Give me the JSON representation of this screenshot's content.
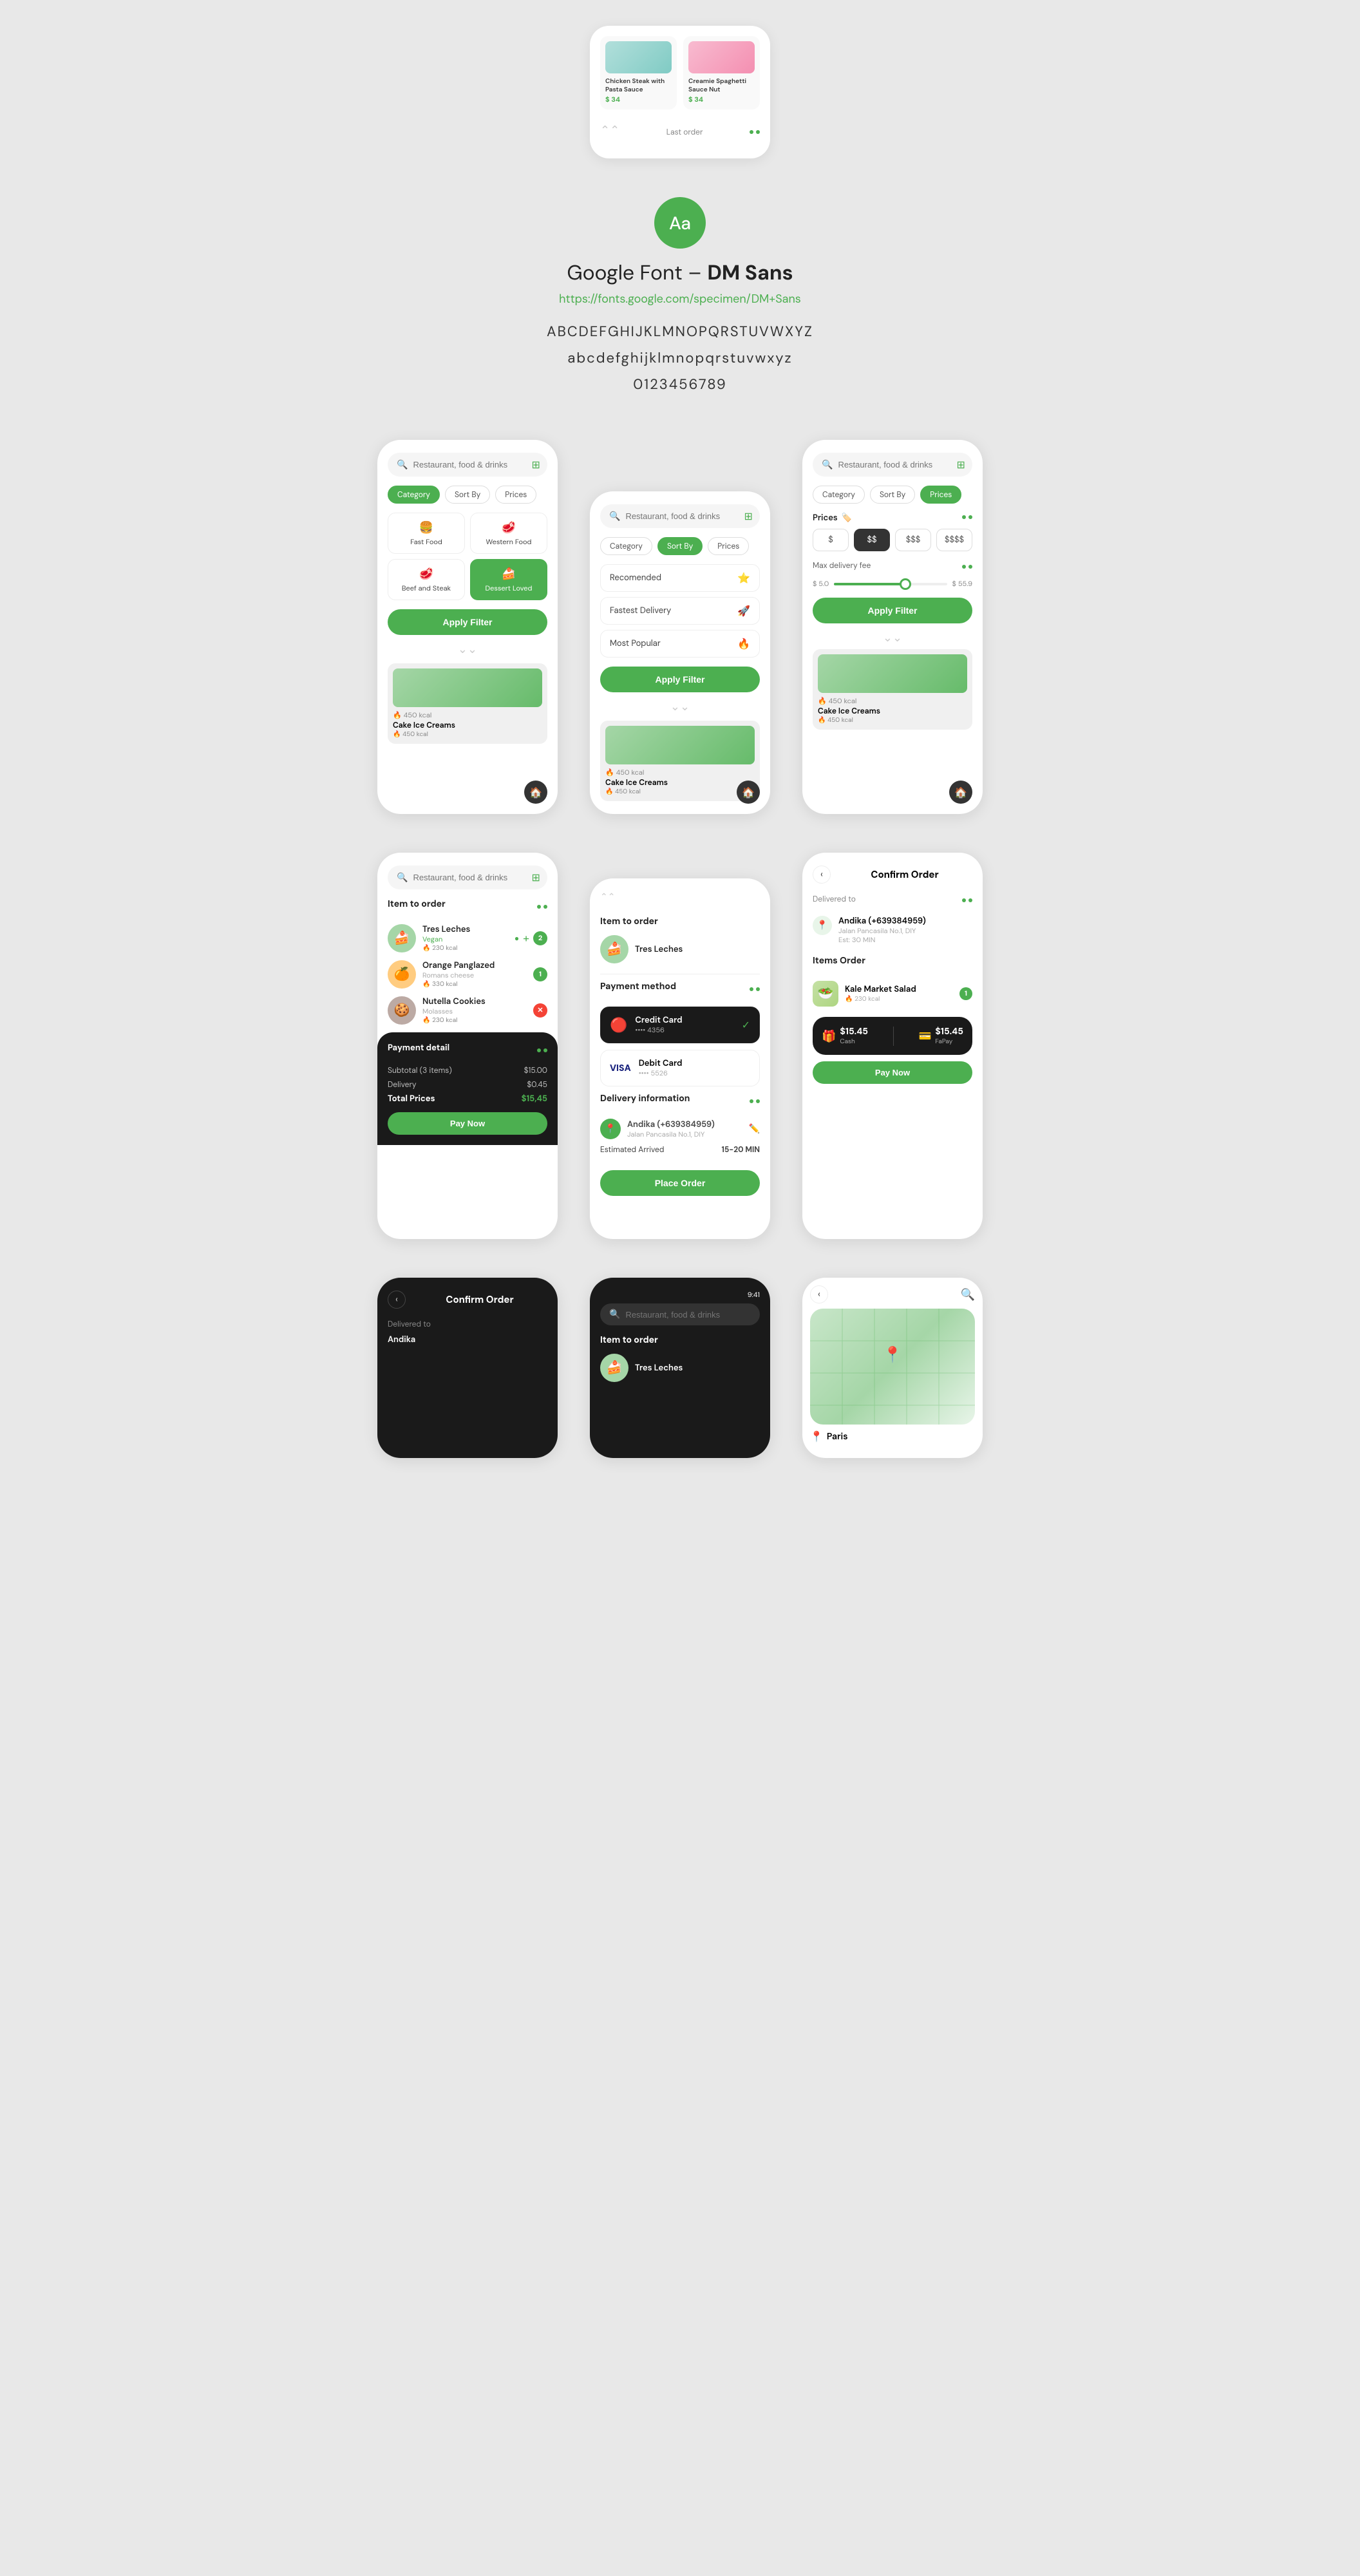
{
  "top": {
    "partial_phone": {
      "food_cards": [
        {
          "name": "Chicken Steak with Pasta Sauce",
          "price": "$ 34"
        },
        {
          "name": "Creamie Spaghetti Sauce Nut",
          "price": "$ 34"
        }
      ],
      "last_order_label": "Last order"
    }
  },
  "font_section": {
    "circle_label": "Aa",
    "title_normal": "Google Font –",
    "title_bold": "DM Sans",
    "link": "https://fonts.google.com/specimen/DM+Sans",
    "uppercase": "ABCDEFGHIJKLMNOPQRSTUVWXYZ",
    "lowercase": "abcdefghijklmnopqrstuvwxyz",
    "numbers": "0123456789"
  },
  "phones_row1": {
    "phone1": {
      "search_placeholder": "Restaurant, food & drinks",
      "pills": [
        "Category",
        "Sort By",
        "Prices"
      ],
      "active_pill": "Category",
      "categories": [
        {
          "icon": "🍔",
          "label": "Fast Food",
          "active": false
        },
        {
          "icon": "🥩",
          "label": "Western Food",
          "active": false
        },
        {
          "icon": "🥩",
          "label": "Beef and Steak",
          "active": false
        },
        {
          "icon": "🍰",
          "label": "Dessert Loved",
          "active": true
        }
      ],
      "apply_btn": "Apply Filter"
    },
    "phone2": {
      "search_placeholder": "Restaurant, food & drinks",
      "pills": [
        "Category",
        "Sort By",
        "Prices"
      ],
      "active_pill": "Sort By",
      "sort_options": [
        {
          "label": "Recomended",
          "icon": "⭐"
        },
        {
          "label": "Fastest Delivery",
          "icon": "🚀"
        },
        {
          "label": "Most Popular",
          "icon": "🔥"
        }
      ],
      "apply_btn": "Apply Filter"
    },
    "phone3": {
      "search_placeholder": "Restaurant, food & drinks",
      "pills": [
        "Category",
        "Sort By",
        "Prices"
      ],
      "active_pill": "Prices",
      "prices_label": "Prices",
      "price_options": [
        "$",
        "$$",
        "$$$",
        "$$$$"
      ],
      "active_price": "$$",
      "delivery_label": "Max delivery fee",
      "slider_min": "$ 5.0",
      "slider_max": "$ 55.9",
      "apply_btn": "Apply Filter"
    }
  },
  "phones_row2": {
    "phone1": {
      "search_placeholder": "Restaurant, food & drinks",
      "section_title": "Item to order",
      "items": [
        {
          "name": "Tres Leches",
          "sub": "Vegan",
          "cal": "230 kcal",
          "qty": 2,
          "badge_color": "green"
        },
        {
          "name": "Orange Panglazed",
          "sub": "Romans cheese",
          "cal": "330 kcal",
          "qty": 1,
          "badge_color": "green"
        },
        {
          "name": "Nutella Cookies",
          "sub": "Molasses",
          "cal": "230 kcal",
          "qty": null,
          "badge_color": "red"
        }
      ],
      "payment_detail": {
        "title": "Payment detail",
        "subtotal_label": "Subtotal (3 items)",
        "subtotal_val": "$15.00",
        "delivery_label": "Delivery",
        "delivery_val": "$0.45",
        "total_label": "Total Prices",
        "total_val": "$15,45",
        "pay_btn": "Pay Now"
      }
    },
    "phone2": {
      "section_title": "Item to order",
      "item_name": "Tres Leches",
      "payment_method_title": "Payment method",
      "payment_methods": [
        {
          "name": "Credit Card",
          "num": "•••• 4356",
          "icon": "💳",
          "active": true
        },
        {
          "name": "Debit Card",
          "num": "•••• 5526",
          "icon": "💳",
          "active": false
        }
      ],
      "delivery_info_title": "Delivery information",
      "delivery_name": "Andika (+639384959)",
      "delivery_addr": "Jalan Pancasila No.1, DIY",
      "eta_label": "Estimated Arrived",
      "eta_val": "15-20 MIN",
      "place_order_btn": "Place Order"
    },
    "phone3": {
      "confirm_title": "Confirm Order",
      "delivered_to": "Delivered to",
      "recipient_name": "Andika (+639384959)",
      "recipient_addr": "Jalan Pancasila No.1, DIY",
      "est_label": "Est: 30 MIN",
      "items_order_title": "Items Order",
      "order_item": {
        "name": "Kale Market Salad",
        "cal": "230 kcal",
        "qty": 1
      },
      "bottom_bar": {
        "cash_label": "Cash",
        "cash_val": "$15.45",
        "fapay_label": "FaPay",
        "fapay_val": "$15.45"
      },
      "confirm_btn": "Confirm Order",
      "pay_btn": "Pay Now"
    }
  },
  "phones_row3": {
    "phone1": {
      "title": "Confirm Order",
      "delivered_to": "Delivered to",
      "recipient": "Andika",
      "dark": true
    },
    "phone2": {
      "search_placeholder": "Restaurant, food & drinks",
      "dark": true,
      "time": "9:41"
    },
    "phone3": {
      "location": "Paris",
      "search_icon": "🔍",
      "map_bg": true
    }
  },
  "colors": {
    "green": "#4caf50",
    "dark": "#1a1a1a",
    "light_bg": "#e8e8e8"
  }
}
